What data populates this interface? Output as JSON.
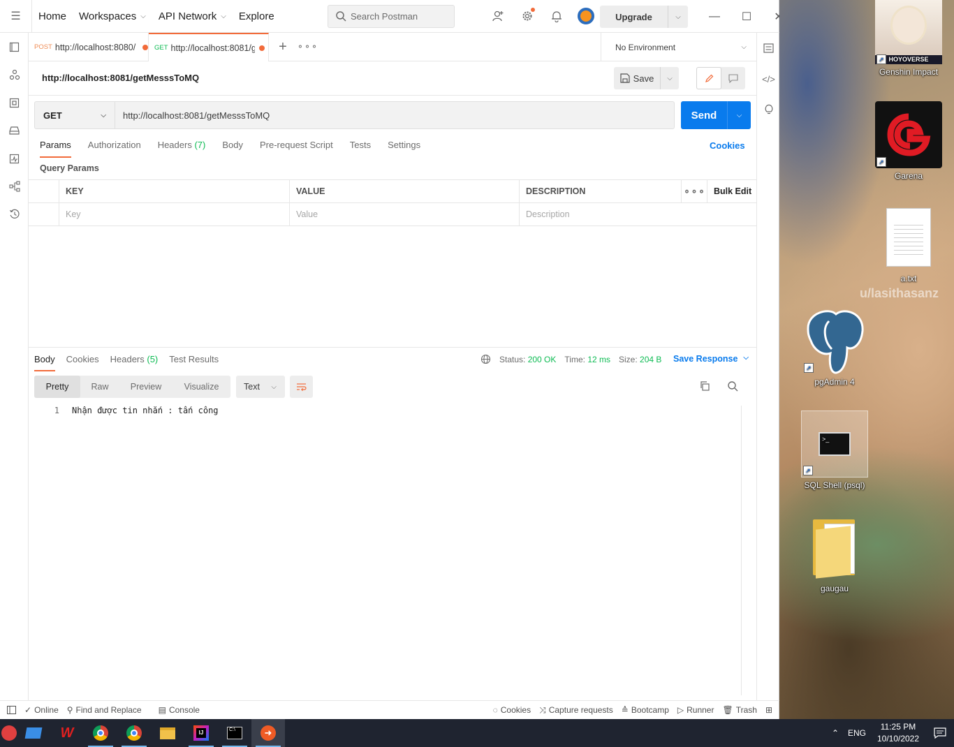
{
  "nav": {
    "home": "Home",
    "workspaces": "Workspaces",
    "api_network": "API Network",
    "explore": "Explore"
  },
  "search": {
    "placeholder": "Search Postman"
  },
  "upgrade": {
    "label": "Upgrade"
  },
  "tabs": [
    {
      "method": "POST",
      "url": "http://localhost:8080/",
      "unsaved": true
    },
    {
      "method": "GET",
      "url": "http://localhost:8081/g",
      "unsaved": true
    }
  ],
  "environment": {
    "selected": "No Environment"
  },
  "request": {
    "title": "http://localhost:8081/getMesssToMQ",
    "method": "GET",
    "url": "http://localhost:8081/getMesssToMQ",
    "save_label": "Save",
    "send_label": "Send"
  },
  "request_tabs": {
    "params": "Params",
    "authorization": "Authorization",
    "headers": "Headers",
    "headers_count": "(7)",
    "body": "Body",
    "prerequest": "Pre-request Script",
    "tests": "Tests",
    "settings": "Settings",
    "cookies": "Cookies"
  },
  "query_params": {
    "title": "Query Params",
    "columns": {
      "key": "KEY",
      "value": "VALUE",
      "description": "DESCRIPTION",
      "bulk_edit": "Bulk Edit"
    },
    "placeholders": {
      "key": "Key",
      "value": "Value",
      "description": "Description"
    }
  },
  "response": {
    "tabs": {
      "body": "Body",
      "cookies": "Cookies",
      "headers": "Headers",
      "headers_count": "(5)",
      "test_results": "Test Results"
    },
    "status_label": "Status:",
    "status": "200 OK",
    "time_label": "Time:",
    "time": "12 ms",
    "size_label": "Size:",
    "size": "204 B",
    "save_response": "Save Response",
    "formats": [
      "Pretty",
      "Raw",
      "Preview",
      "Visualize"
    ],
    "active_format": "Pretty",
    "type": "Text",
    "lines": [
      {
        "n": "1",
        "text": "Nhận được tin nhắn : tấn công"
      }
    ]
  },
  "statusbar": {
    "online": "Online",
    "find_replace": "Find and Replace",
    "console": "Console",
    "cookies": "Cookies",
    "capture": "Capture requests",
    "bootcamp": "Bootcamp",
    "runner": "Runner",
    "trash": "Trash"
  },
  "desktop": {
    "icons": [
      {
        "label": "Genshin Impact",
        "badge": "HOYOVERSE"
      },
      {
        "label": "Garena"
      },
      {
        "label": "a.txt"
      },
      {
        "label": "pgAdmin 4"
      },
      {
        "label": "SQL Shell (psql)"
      },
      {
        "label": "gaugau"
      }
    ],
    "watermark": "u/lasithasanz"
  },
  "taskbar": {
    "lang": "ENG",
    "time": "11:25 PM",
    "date": "10/10/2022"
  },
  "colors": {
    "accent": "#f26b3a",
    "send": "#097bed",
    "success": "#0cbb52"
  }
}
